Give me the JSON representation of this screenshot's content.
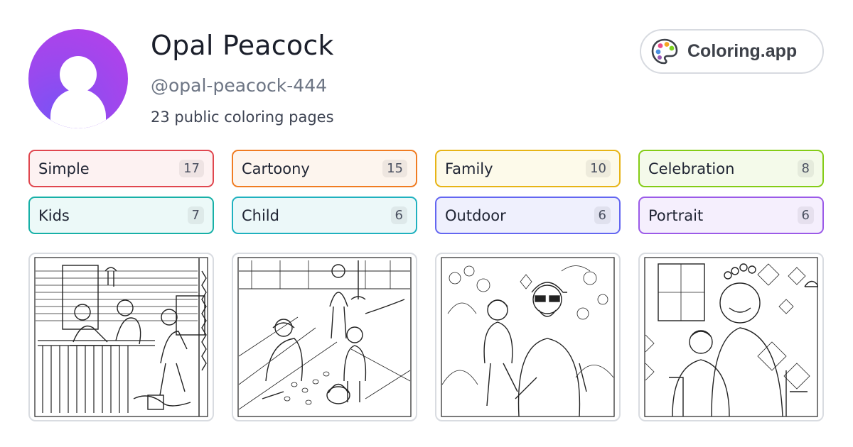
{
  "profile": {
    "name": "Opal Peacock",
    "handle": "@opal-peacock-444",
    "pages_count_text": "23 public coloring pages",
    "avatar_icon": "user-silhouette-icon",
    "avatar_gradient": [
      "#7b52f5",
      "#b93fe9"
    ]
  },
  "brand": {
    "label": "Coloring.app",
    "icon": "palette-icon"
  },
  "tags": [
    {
      "label": "Simple",
      "count": "17",
      "border": "#e0474f",
      "bg": "#fdf2f2"
    },
    {
      "label": "Cartoony",
      "count": "15",
      "border": "#f07c22",
      "bg": "#fdf5ee"
    },
    {
      "label": "Family",
      "count": "10",
      "border": "#e7b416",
      "bg": "#fdfaea"
    },
    {
      "label": "Celebration",
      "count": "8",
      "border": "#84cc16",
      "bg": "#f4faea"
    },
    {
      "label": "Kids",
      "count": "7",
      "border": "#17b0a7",
      "bg": "#ecf9f8"
    },
    {
      "label": "Child",
      "count": "6",
      "border": "#1fb1bf",
      "bg": "#ecf8f9"
    },
    {
      "label": "Outdoor",
      "count": "6",
      "border": "#6366f1",
      "bg": "#eff0fd"
    },
    {
      "label": "Portrait",
      "count": "6",
      "border": "#9b5ae8",
      "bg": "#f5effd"
    }
  ],
  "thumbnails": [
    {
      "subject": "porch-family-scene"
    },
    {
      "subject": "easter-egg-hunt-scene"
    },
    {
      "subject": "grandpa-and-toddler-garden-scene"
    },
    {
      "subject": "birthday-grandpa-and-child-scene"
    }
  ]
}
